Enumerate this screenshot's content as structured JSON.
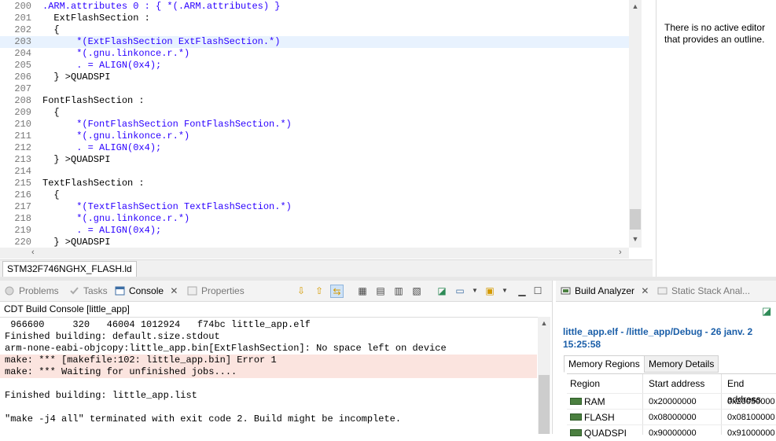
{
  "editor": {
    "lines": [
      {
        "num": "200",
        "text": ".ARM.attributes 0 : { *(.ARM.attributes) }"
      },
      {
        "num": "201",
        "text": "  ExtFlashSection :"
      },
      {
        "num": "202",
        "text": "  {"
      },
      {
        "num": "203",
        "text": "      *(ExtFlashSection ExtFlashSection.*)"
      },
      {
        "num": "204",
        "text": "      *(.gnu.linkonce.r.*)"
      },
      {
        "num": "205",
        "text": "      . = ALIGN(0x4);"
      },
      {
        "num": "206",
        "text": "  } >QUADSPI"
      },
      {
        "num": "207",
        "text": ""
      },
      {
        "num": "208",
        "text": "FontFlashSection :"
      },
      {
        "num": "209",
        "text": "  {"
      },
      {
        "num": "210",
        "text": "      *(FontFlashSection FontFlashSection.*)"
      },
      {
        "num": "211",
        "text": "      *(.gnu.linkonce.r.*)"
      },
      {
        "num": "212",
        "text": "      . = ALIGN(0x4);"
      },
      {
        "num": "213",
        "text": "  } >QUADSPI"
      },
      {
        "num": "214",
        "text": ""
      },
      {
        "num": "215",
        "text": "TextFlashSection :"
      },
      {
        "num": "216",
        "text": "  {"
      },
      {
        "num": "217",
        "text": "      *(TextFlashSection TextFlashSection.*)"
      },
      {
        "num": "218",
        "text": "      *(.gnu.linkonce.r.*)"
      },
      {
        "num": "219",
        "text": "      . = ALIGN(0x4);"
      },
      {
        "num": "220",
        "text": "  } >QUADSPI"
      }
    ],
    "highlighted_line": "203",
    "file_tab": "STM32F746NGHX_FLASH.ld"
  },
  "outline": {
    "message": "There is no active editor that provides an outline."
  },
  "console_panel": {
    "tabs": {
      "problems": "Problems",
      "tasks": "Tasks",
      "console": "Console",
      "properties": "Properties"
    },
    "title": "CDT Build Console [little_app]",
    "lines": [
      {
        "text": " 966600     320   46004 1012924   f74bc little_app.elf",
        "error": false
      },
      {
        "text": "Finished building: default.size.stdout",
        "error": false
      },
      {
        "text": "arm-none-eabi-objcopy:little_app.bin[ExtFlashSection]: No space left on device",
        "error": false
      },
      {
        "text": "make: *** [makefile:102: little_app.bin] Error 1",
        "error": true
      },
      {
        "text": "make: *** Waiting for unfinished jobs....",
        "error": true
      },
      {
        "text": "",
        "error": false
      },
      {
        "text": "Finished building: little_app.list",
        "error": false
      },
      {
        "text": "",
        "error": false
      },
      {
        "text": "\"make -j4 all\" terminated with exit code 2. Build might be incomplete.",
        "error": false
      }
    ]
  },
  "analyzer": {
    "tabs": {
      "build_analyzer": "Build Analyzer",
      "stack_analyzer": "Static Stack Anal..."
    },
    "heading_line1": "little_app.elf - /little_app/Debug - 26 janv. 2",
    "heading_line2": "15:25:58",
    "subtabs": {
      "regions": "Memory Regions",
      "details": "Memory Details"
    },
    "columns": {
      "region": "Region",
      "start": "Start address",
      "end": "End address"
    },
    "rows": [
      {
        "region": "RAM",
        "start": "0x20000000",
        "end": "0x20050000"
      },
      {
        "region": "FLASH",
        "start": "0x08000000",
        "end": "0x08100000"
      },
      {
        "region": "QUADSPI",
        "start": "0x90000000",
        "end": "0x91000000"
      }
    ]
  },
  "colors": {
    "error_background": "#fbe4df",
    "highlight_line": "#e8f2fe",
    "heading_blue": "#1a5ea8"
  }
}
